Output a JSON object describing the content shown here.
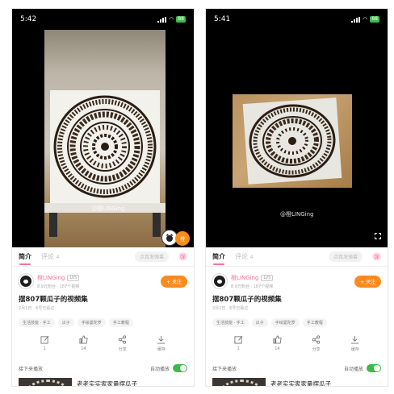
{
  "left": {
    "status": {
      "time": "5:42",
      "battery": "88"
    },
    "watermark": "@橙LINGing",
    "float_badge": "橙"
  },
  "right": {
    "status": {
      "time": "5:41",
      "battery": "88"
    },
    "watermark": "@橙LINGing"
  },
  "tabs": {
    "intro": "简介",
    "comments": "评论",
    "comments_count": "4",
    "danmaku_placeholder": "点我发弹幕",
    "danmaku_icon": "弹"
  },
  "uploader": {
    "name": "橙LINGing",
    "level": "LV5",
    "stats": "8.9万粉丝 · 187个视频",
    "follow": "+ 关注"
  },
  "video": {
    "title": "摆807颗瓜子的视频集",
    "meta": "2月1日 · 6号已看过",
    "tags": [
      "生活技能 · 手工",
      "瓜子",
      "手绘曼陀罗",
      "手工教程"
    ]
  },
  "actions": [
    {
      "label": "1",
      "icon": "share-edit-icon"
    },
    {
      "label": "14",
      "icon": "like-icon"
    },
    {
      "label": "分享",
      "icon": "share-icon"
    },
    {
      "label": "缓存",
      "icon": "download-icon"
    }
  ],
  "autoplay": {
    "next": "接下来播放",
    "auto": "自动播放"
  },
  "recommend": {
    "title": "老老实实家家量摆瓜子"
  },
  "colors": {
    "accent": "#fb7299",
    "follow": "#ff8a1c",
    "toggle": "#3dbb4a"
  }
}
